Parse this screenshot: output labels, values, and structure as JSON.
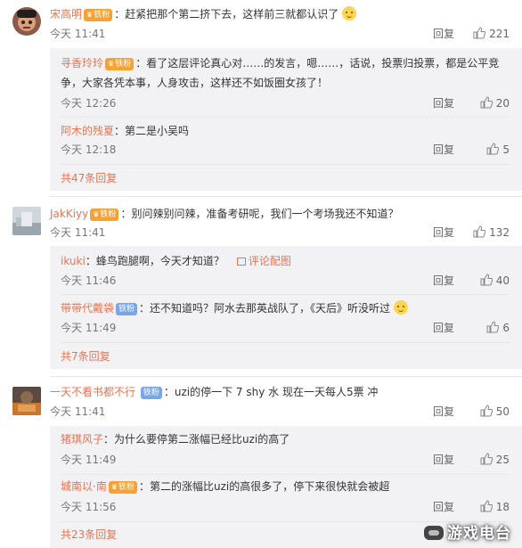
{
  "threads": [
    {
      "user": "宋高明",
      "badge": "铁粉",
      "text": "：赶紧把那个第二挤下去，这样前三就都认识了",
      "time": "今天 11:41",
      "reply_label": "回复",
      "likes": "221",
      "replies": [
        {
          "user": "寻香玲玲",
          "badge": "铁粉",
          "text": "：看了这层评论真心对……的发言，嗯……，话说，投票归投票，都是公平竞争，大家各凭本事，人身攻击，这样还不如饭圈女孩了！",
          "time": "今天 12:26",
          "reply_label": "回复",
          "likes": "20"
        },
        {
          "user": "阿木的残夏",
          "text": "：第二是小吴吗",
          "time": "今天 12:18",
          "reply_label": "回复",
          "likes": "5"
        }
      ],
      "more": "共47条回复"
    },
    {
      "user": "JakKiyy",
      "badge": "铁粉",
      "text": "：别问辣别问辣，准备考研呢，我们一个考场我还不知道？",
      "time": "今天 11:41",
      "reply_label": "回复",
      "likes": "132",
      "replies": [
        {
          "user": "ikuki",
          "text": "：蜂鸟跑腿啊，今天才知道？",
          "pic_label": "评论配图",
          "time": "今天 11:46",
          "reply_label": "回复",
          "likes": "40"
        },
        {
          "user": "带带代戴袋",
          "badge": "铁粉",
          "text": "：还不知道吗？阿水去那英战队了，《天后》听没听过",
          "time": "今天 11:49",
          "reply_label": "回复",
          "likes": "6"
        }
      ],
      "more": "共7条回复"
    },
    {
      "user": "一天不看书都不行",
      "badge": "铁粉",
      "text": "：uzi的停一下 7 shy 水 现在一天每人5票 冲",
      "time": "今天 11:41",
      "reply_label": "回复",
      "likes": "50",
      "replies": [
        {
          "user": "猪琪风子",
          "text": "：为什么要停第二涨幅已经比uzi的高了",
          "time": "今天 11:49",
          "reply_label": "回复",
          "likes": "25"
        },
        {
          "user": "城南以·南",
          "badge": "铁粉",
          "text": "：第二的涨幅比uzi的高很多了，停下来很快就会被超",
          "time": "今天 11:56",
          "reply_label": "回复",
          "likes": "18"
        }
      ],
      "more": "共23条回复"
    }
  ],
  "watermark": "游戏电台",
  "colors": {
    "name": "#eb7350",
    "badge_gold": "#f4a236",
    "badge_blue": "#7aa6e5",
    "reply_bg": "#f2f2f5"
  }
}
